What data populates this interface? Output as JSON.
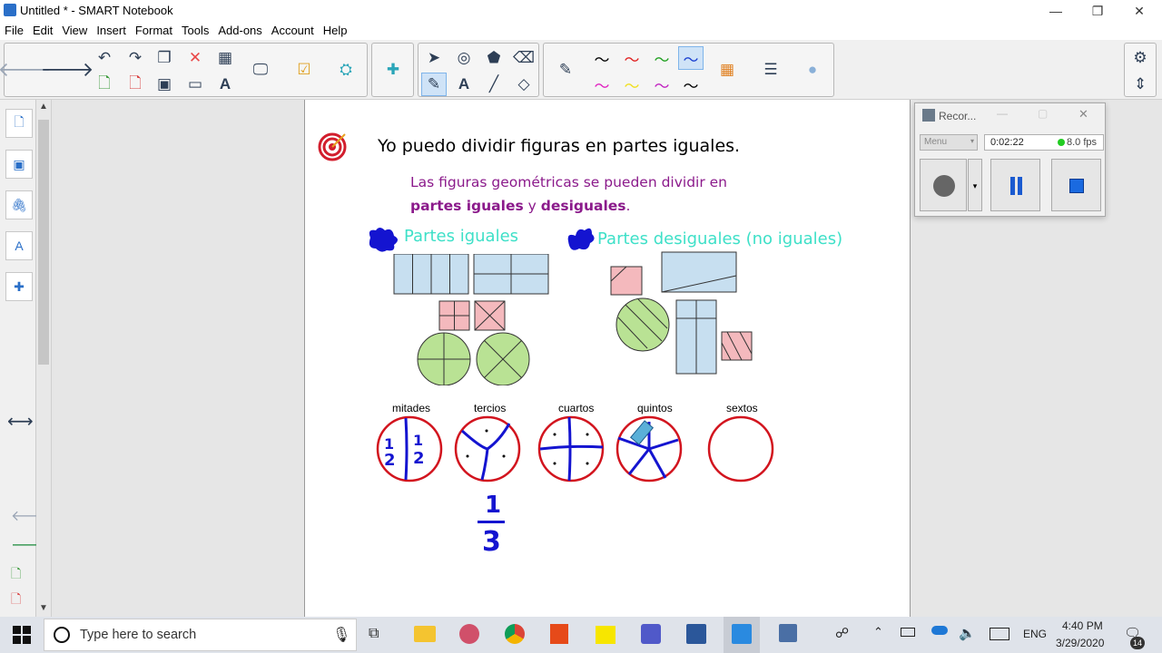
{
  "window": {
    "title": "Untitled * - SMART Notebook",
    "minimize_glyph": "—",
    "restore_glyph": "❐",
    "close_glyph": "✕"
  },
  "menu": [
    "File",
    "Edit",
    "View",
    "Insert",
    "Format",
    "Tools",
    "Add-ons",
    "Account",
    "Help"
  ],
  "page": {
    "heading": "Yo puedo dividir figuras en partes iguales.",
    "subtitle_line1": "Las figuras geométricas se pueden dividir en",
    "subtitle_bold1": "partes iguales",
    "subtitle_y": " y ",
    "subtitle_bold2": "desiguales",
    "subtitle_end": ".",
    "label_equal": "Partes iguales",
    "label_unequal": "Partes desiguales (no iguales)",
    "circle_labels": [
      "mitades",
      "tercios",
      "cuartos",
      "quintos",
      "sextos"
    ],
    "fraction_num": "1",
    "fraction_den": "3"
  },
  "recorder": {
    "title": "Recor...",
    "menu": "Menu",
    "time": "0:02:22",
    "fps": "8.0 fps"
  },
  "taskbar": {
    "search_placeholder": "Type here to search",
    "lang": "ENG",
    "time": "4:40 PM",
    "date": "3/29/2020",
    "notif_count": "14"
  },
  "colors": {
    "shape_blue": "#c7dff0",
    "shape_pink": "#f4b9bd",
    "shape_green": "#b9e294",
    "teal_label": "#3ee0c8",
    "purple_text": "#8b1a8b",
    "ink_blue": "#1414d0",
    "circle_red": "#d2141e"
  }
}
